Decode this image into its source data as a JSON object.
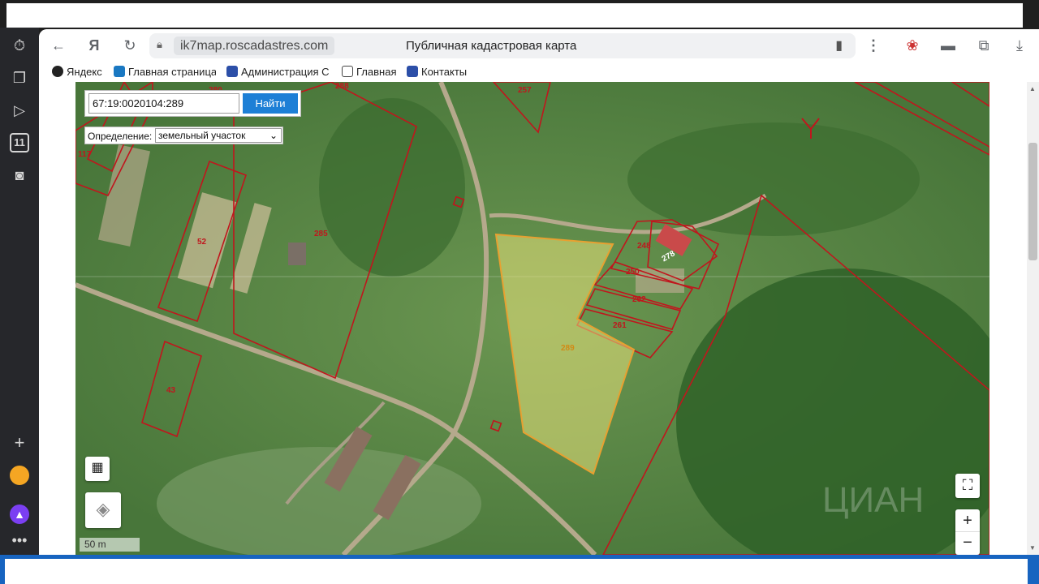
{
  "browser": {
    "url_host": "ik7map.roscadastres.com",
    "page_title": "Публичная кадастровая карта"
  },
  "bookmarks": [
    {
      "label": "Яндекс",
      "icon": "yandex-plus-icon"
    },
    {
      "label": "Главная страница",
      "icon": "gosuslugi-icon"
    },
    {
      "label": "Администрация С",
      "icon": "emblem-icon"
    },
    {
      "label": "Главная",
      "icon": "page-icon"
    },
    {
      "label": "Контакты",
      "icon": "emblem-icon"
    }
  ],
  "search": {
    "value": "67:19:0020104:289",
    "button_label": "Найти"
  },
  "definition": {
    "label": "Определение:",
    "selected": "земельный участок"
  },
  "map": {
    "scale_label": "50 m",
    "zoom_in": "+",
    "zoom_out": "−",
    "watermark": "ЦИАН",
    "plots": [
      {
        "id": "289",
        "selected": true
      },
      {
        "id": "285"
      },
      {
        "id": "52"
      },
      {
        "id": "43"
      },
      {
        "id": "117"
      },
      {
        "id": "280"
      },
      {
        "id": "288"
      },
      {
        "id": "257"
      },
      {
        "id": "248"
      },
      {
        "id": "278"
      },
      {
        "id": "250"
      },
      {
        "id": "262"
      },
      {
        "id": "261"
      }
    ]
  },
  "colors": {
    "boundary": "#c0161d",
    "selected_fill": "#e8e27a",
    "selected_stroke": "#e8a030",
    "find_button": "#1d7fd6"
  }
}
